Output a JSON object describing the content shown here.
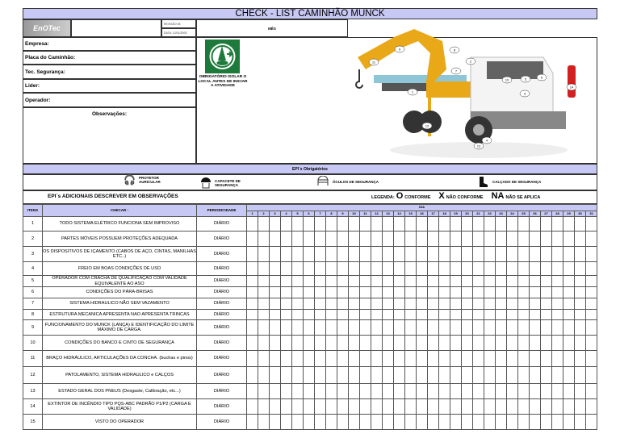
{
  "title": "CHECK - LIST  CAMINHÃO MUNCK",
  "logo": "EnOTec",
  "revision": "REVISÃO 08",
  "date": "DATA: 12/01/2005",
  "month_label": "MÊS",
  "fields": [
    "Empresa:",
    "Placa do Caminhão:",
    "Tec. Segurança:",
    "Lider:",
    "Operador:"
  ],
  "observations_label": "Observações:",
  "safety_sign_text": "OBRIGATÓRIO ISOLAR O LOCAL ANTES DE INICIAR A ATIVIDADE",
  "truck_callouts": [
    "1",
    "2",
    "3",
    "4",
    "5",
    "6",
    "7",
    "8",
    "9",
    "10",
    "11",
    "12",
    "13",
    "14"
  ],
  "epi": {
    "header": "EPI´s Obrigatórios",
    "items": [
      {
        "icon": "ear-protector-icon",
        "label": "PROTETOR AURICULAR"
      },
      {
        "icon": "helmet-icon",
        "label": "CAPACETE DE SEGURANÇA"
      },
      {
        "icon": "safety-goggles-icon",
        "label": "ÓCULOS DE SEGURANÇA"
      },
      {
        "icon": "safety-boot-icon",
        "label": "CALÇADO DE SEGURANÇA"
      }
    ],
    "additional": "EPI´s ADICIONAIS DESCREVER EM OBSERVAÇÕES"
  },
  "legend": {
    "label": "LEGENDA:",
    "o": "O",
    "o_text": "CONFORME",
    "x": "X",
    "x_text": "NÃO CONFORME",
    "na": "NA",
    "na_text": "NÃO SE APLICA"
  },
  "table": {
    "headers": {
      "items": "ITENS",
      "check": "CHECAR :",
      "period": "PERIODICIDADE",
      "day": "DIA"
    },
    "days": [
      "1",
      "2",
      "3",
      "4",
      "5",
      "6",
      "7",
      "8",
      "9",
      "10",
      "11",
      "12",
      "13",
      "14",
      "15",
      "16",
      "17",
      "18",
      "19",
      "20",
      "21",
      "22",
      "23",
      "24",
      "25",
      "26",
      "27",
      "28",
      "29",
      "30",
      "31"
    ],
    "rows": [
      {
        "n": "1",
        "check": "TODO SISTEMA ELÉTRICO FUNCIONA SEM IMPROVISO",
        "period": "DIÁRIO"
      },
      {
        "n": "2",
        "check": "PARTES MÓVEIS POSSUEM PROTEÇÕES ADEQUADA",
        "period": "DIÁRIO"
      },
      {
        "n": "3",
        "check": "OS DISPOSITIVOS DE IÇAMENTO (CABOS DE AÇO, CINTAS, MANILHAS ETC..)",
        "period": "DIÁRIO"
      },
      {
        "n": "4",
        "check": "FREIO EM BOAS CONDIÇÕES DE USO",
        "period": "DIÁRIO"
      },
      {
        "n": "5",
        "check": "OPERADOR COM CRACHA DE QUALIFICAÇÃO COM VALIDADE EQUIVALENTE AO ASO",
        "period": "DIÁRIO"
      },
      {
        "n": "6",
        "check": "CONDIÇÕES DO PÁRA-BRISAS",
        "period": "DIÁRIO"
      },
      {
        "n": "7",
        "check": "SISTEMA HIDRAULICO NÃO  SEM VAZAMENTO",
        "period": "DIÁRIO"
      },
      {
        "n": "8",
        "check": "ESTRUTURA MECANICA APRESENTA NAO APRESENTA TRINCAS",
        "period": "DIÁRIO"
      },
      {
        "n": "9",
        "check": "FUNCIONAMENTO DO MUNCK (LANÇA) E IDENTIFICAÇÃO DO LIMITE MÁXIMO DE CARGA.",
        "period": "DIÁRIO"
      },
      {
        "n": "10",
        "check": "CONDIÇÕES DO BANCO E CINTO DE SEGURANÇA",
        "period": "DIÁRIO"
      },
      {
        "n": "11",
        "check": "BRAÇO HIDRÁULICO, ARTICULAÇÕES DA CONCHA. (buchas e pinos)",
        "period": "DIÁRIO"
      },
      {
        "n": "12",
        "check": "PATOLAMENTO, SISTEMA HIDRAULICO e CALÇOS",
        "period": "DIÁRIO"
      },
      {
        "n": "13",
        "check": "ESTADO GERAL DOS PNEUS (Desgaste, Calibração, etc...)",
        "period": "DIÁRIO"
      },
      {
        "n": "14",
        "check": "EXTINTOR DE INCÊNDIO TIPO PQS-ABC PADRÃO P1/P2 (CARGA E VALIDADE)",
        "period": "DIÁRIO"
      },
      {
        "n": "15",
        "check": "VISTO DO OPERADOR",
        "period": "DIÁRIO"
      }
    ]
  },
  "colors": {
    "header_bg": "#c8c8f5",
    "sign_green": "#1e7a3a",
    "crane_yellow": "#e8a818"
  }
}
